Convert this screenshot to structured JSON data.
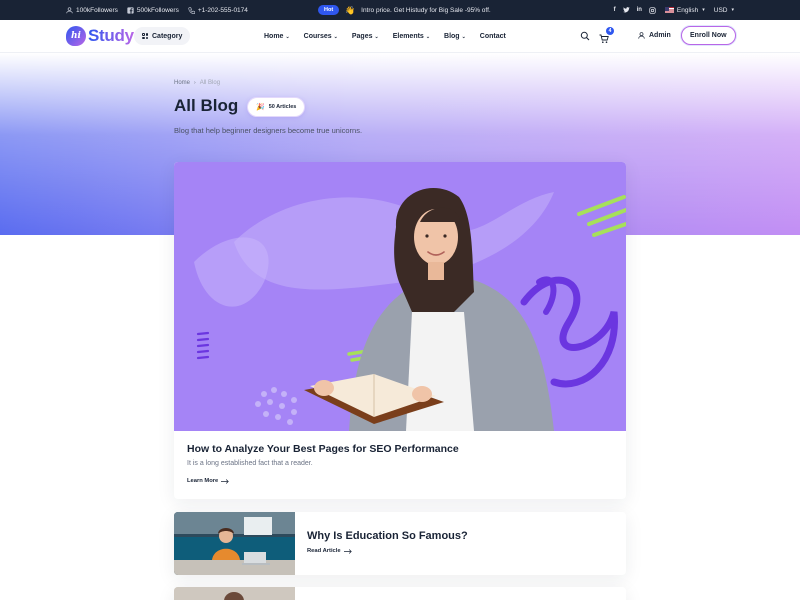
{
  "topbar": {
    "followers_1": "100kFollowers",
    "followers_2": "500kFollowers",
    "phone": "+1-202-555-0174",
    "hot_badge": "Hot",
    "promo_text": "Intro price. Get Histudy for Big Sale -95% off.",
    "language": "English",
    "currency": "USD"
  },
  "header": {
    "logo_text": "Study",
    "logo_mark": "hi",
    "category_label": "Category",
    "nav": [
      "Home",
      "Courses",
      "Pages",
      "Elements",
      "Blog",
      "Contact"
    ],
    "cart_count": "4",
    "admin_label": "Admin",
    "enroll_label": "Enroll Now"
  },
  "hero": {
    "breadcrumb_home": "Home",
    "breadcrumb_current": "All Blog",
    "title": "All Blog",
    "article_count": "50 Articles",
    "subtitle": "Blog that help beginner designers become true unicorns."
  },
  "featured_post": {
    "title": "How to Analyze Your Best Pages for SEO Performance",
    "description": "It is a long established fact that a reader.",
    "link_label": "Learn More"
  },
  "posts": [
    {
      "title": "Why Is Education So Famous?",
      "link_label": "Read Article"
    }
  ],
  "colors": {
    "primary": "#2f57ef",
    "secondary": "#b966e7",
    "heading": "#192335",
    "topbar_bg": "#192335",
    "feature_bg": "#a584f6"
  },
  "icons": {
    "facebook": "facebook-icon",
    "twitter": "twitter-icon",
    "linkedin": "linkedin-icon",
    "instagram": "instagram-icon",
    "search": "search-icon",
    "cart": "cart-icon",
    "user": "user-icon",
    "arrow": "arrow-right-icon"
  }
}
